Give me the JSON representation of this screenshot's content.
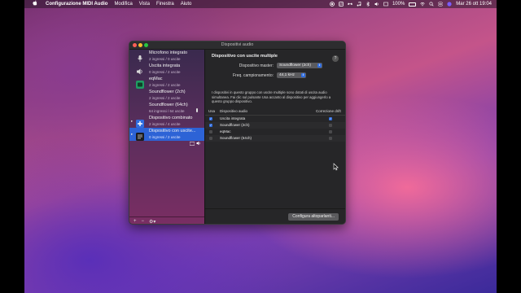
{
  "menubar": {
    "app_name": "Configurazione MIDI Audio",
    "menus": [
      "Modifica",
      "Vista",
      "Finestra",
      "Aiuto"
    ],
    "battery": "100%",
    "datetime": "Mar 26 ott 19:04"
  },
  "window": {
    "title": "Dispositivi audio",
    "colors": {
      "close": "#ff5f57",
      "minimize": "#febc2e",
      "zoom": "#28c840"
    }
  },
  "sidebar": {
    "devices": [
      {
        "name": "Microfono integrato",
        "io": "2 ingressi / 0 uscite",
        "icon": "microphone-icon"
      },
      {
        "name": "Uscita integrata",
        "io": "0 ingressi / 2 uscite",
        "icon": "speaker-icon"
      },
      {
        "name": "eqMac",
        "io": "2 ingressi / 2 uscite",
        "icon": "eqmac-app-icon"
      },
      {
        "name": "Soundflower (2ch)",
        "io": "2 ingressi / 2 uscite",
        "icon": "soundflower-icon"
      },
      {
        "name": "Soundflower (64ch)",
        "io": "64 ingressi / 64 uscite",
        "icon": "soundflower-icon"
      },
      {
        "name": "Dispositivo combinato",
        "io": "2 ingressi / 4 uscite",
        "icon": "aggregate-device-icon"
      },
      {
        "name": "Dispositivo con uscite...",
        "io": "0 ingressi / 2 uscite",
        "icon": "multi-output-device-icon"
      }
    ],
    "bottom": {
      "add": "+",
      "remove": "−",
      "gear": "⚙",
      "chevron": "▾"
    }
  },
  "main": {
    "heading": "Dispositivo con uscite multiple",
    "help": "?",
    "master_label": "Dispositivo master:",
    "master_value": "Soundflower (2ch)",
    "rate_label": "Freq. campionamento:",
    "rate_value": "44,1 kHz",
    "description": "I dispositivi in questo gruppo con uscite multiple sono dotati di uscita audio simultanea. Fai clic sul pulsante Usa accanto al dispositivo per aggiungerlo a questo gruppo dispositivo.",
    "table": {
      "headers": {
        "use": "Usa",
        "device": "Dispositivo audio",
        "drift": "Correzione drift"
      },
      "rows": [
        {
          "name": "Uscita integrata",
          "use": true,
          "drift": true
        },
        {
          "name": "Soundflower (2ch)",
          "use": true,
          "drift": false
        },
        {
          "name": "eqMac",
          "use": false,
          "drift": false
        },
        {
          "name": "Soundflower (64ch)",
          "use": false,
          "drift": false
        }
      ]
    },
    "configure_button": "Configura altoparlanti..."
  }
}
